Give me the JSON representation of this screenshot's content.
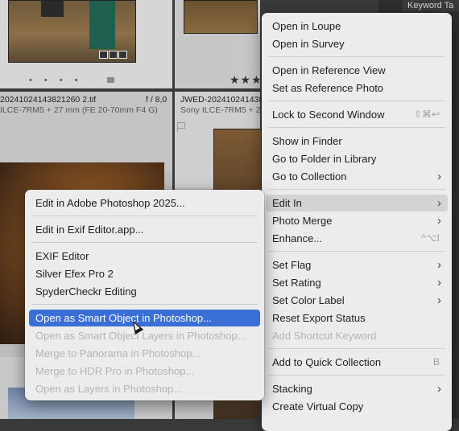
{
  "panel": {
    "keyword_title": "Keyword Ta"
  },
  "grid": {
    "left_filename": "20241024143821260 2.tif",
    "left_aperture": "f / 8,0",
    "left_camera": "ILCE-7RM5 + 27 mm (FE 20-70mm F4 G)",
    "right_filename": "JWED-202410241438",
    "right_camera": "Sony ILCE-7RM5 + 2",
    "dots": "• • • •",
    "stars": "★★★"
  },
  "main_menu": {
    "items": [
      {
        "label": "Open in Loupe"
      },
      {
        "label": "Open in Survey"
      },
      {
        "label": "Open in Reference View"
      },
      {
        "label": "Set as Reference Photo"
      },
      {
        "label": "Lock to Second Window",
        "shortcut": "⇧⌘↩"
      },
      {
        "label": "Show in Finder"
      },
      {
        "label": "Go to Folder in Library"
      },
      {
        "label": "Go to Collection"
      },
      {
        "label": "Edit In"
      },
      {
        "label": "Photo Merge"
      },
      {
        "label": "Enhance...",
        "shortcut": "^⌥I"
      },
      {
        "label": "Set Flag"
      },
      {
        "label": "Set Rating"
      },
      {
        "label": "Set Color Label"
      },
      {
        "label": "Reset Export Status"
      },
      {
        "label": "Add Shortcut Keyword"
      },
      {
        "label": "Add to Quick Collection",
        "shortcut": "B"
      },
      {
        "label": "Stacking"
      },
      {
        "label": "Create Virtual Copy"
      }
    ],
    "arrow": "›"
  },
  "sub_menu": {
    "items": [
      {
        "label": "Edit in Adobe Photoshop 2025..."
      },
      {
        "label": "Edit in Exif Editor.app..."
      },
      {
        "label": "EXIF Editor"
      },
      {
        "label": "Silver Efex Pro 2"
      },
      {
        "label": "SpyderCheckr Editing"
      },
      {
        "label": "Open as Smart Object in Photoshop..."
      },
      {
        "label": "Open as Smart Object Layers in Photoshop..."
      },
      {
        "label": "Merge to Panorama in Photoshop..."
      },
      {
        "label": "Merge to HDR Pro in Photoshop..."
      },
      {
        "label": "Open as Layers in Photoshop..."
      }
    ]
  },
  "colors": {
    "selection": "#3a6fd8",
    "menu_bg": "#ececec",
    "disabled": "#b4b4b4"
  }
}
